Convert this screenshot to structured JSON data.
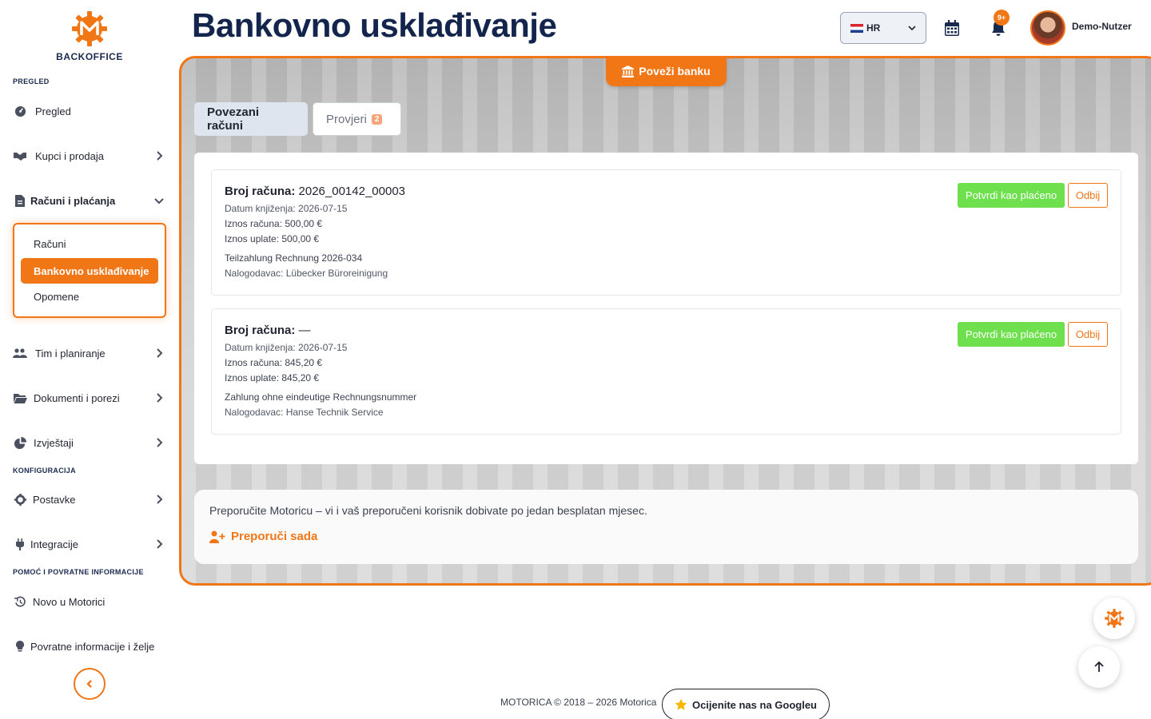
{
  "brand": {
    "name": "BACKOFFICE",
    "accent": "#f07616",
    "navy": "#13244d"
  },
  "sidebar": {
    "sections": {
      "overview": "PREGLED",
      "config": "KONFIGURACIJA",
      "help": "POMOĆ I POVRATNE INFORMACIJE"
    },
    "items": {
      "overview": "Pregled",
      "sales": "Kupci i prodaja",
      "billing": "Računi i plaćanja",
      "team": "Tim i planiranje",
      "docs": "Dokumenti i porezi",
      "reports": "Izvještaji",
      "settings": "Postavke",
      "integrations": "Integracije",
      "news": "Novo u Motorici",
      "feedback": "Povratne informacije i želje"
    },
    "submenu": {
      "invoices": "Računi",
      "bank": "Bankovno usklađivanje",
      "reminders": "Opomene"
    }
  },
  "header": {
    "title": "Bankovno usklađivanje",
    "language": "HR",
    "notifications": "9+",
    "user": "Demo-Nutzer"
  },
  "main": {
    "connect_bank": "Poveži banku",
    "tabs": {
      "linked": "Povezani računi",
      "check": "Provjeri",
      "check_count": "2"
    },
    "transactions": [
      {
        "label": "Broj računa:",
        "number": "2026_00142_00003",
        "date": "Datum knjiženja: 2026-07-15",
        "invoice_amount": "Iznos računa: 500,00 €",
        "payment_amount": "Iznos uplate: 500,00 €",
        "reference": "Teilzahlung Rechnung 2026-034",
        "payer": "Nalogodavac: Lübecker Büroreinigung",
        "confirm": "Potvrdi kao plaćeno",
        "reject": "Odbij"
      },
      {
        "label": "Broj računa:",
        "number": "—",
        "date": "Datum knjiženja: 2026-07-15",
        "invoice_amount": "Iznos računa: 845,20 €",
        "payment_amount": "Iznos uplate: 845,20 €",
        "reference": "Zahlung ohne eindeutige Rechnungsnummer",
        "payer": "Nalogodavac: Hanse Technik Service",
        "confirm": "Potvrdi kao plaćeno",
        "reject": "Odbij"
      }
    ],
    "referral": {
      "text": "Preporučite Motoricu – vi i vaš preporučeni korisnik dobivate po jedan besplatan mjesec.",
      "link": "Preporuči sada"
    }
  },
  "footer": {
    "copyright": "MOTORICA © 2018 – 2026 Motorica",
    "rate": "Ocijenite nas na Googleu"
  }
}
